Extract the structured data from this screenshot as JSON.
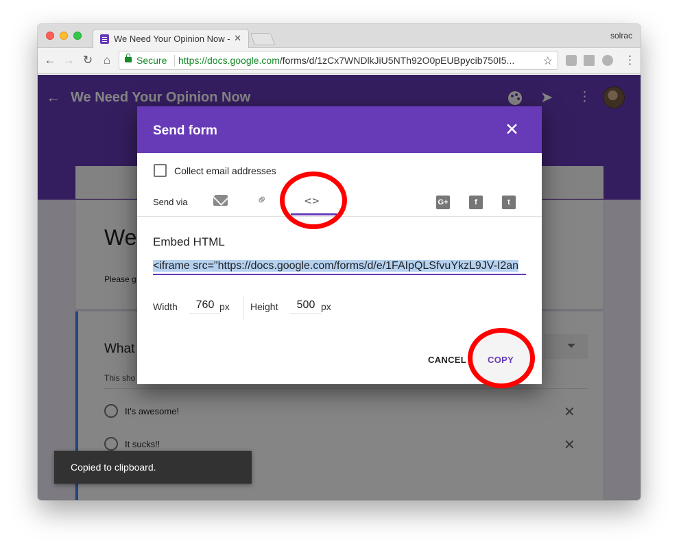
{
  "browser": {
    "tab_title": "We Need Your Opinion Now - G",
    "tab_close": "✕",
    "profile": "solrac",
    "secure_label": "Secure",
    "url_scheme_host": "https://docs.google.com",
    "url_path": "/forms/d/1zCx7WNDlkJiU5NTh92O0pEUBpycib750I5..."
  },
  "form": {
    "title": "We Need Your Opinion Now",
    "card_title": "We",
    "card_desc": "Please g",
    "question_title": "What",
    "question_desc": "This sho",
    "options": [
      {
        "label": "It's awesome!"
      },
      {
        "label": "It sucks!!"
      }
    ]
  },
  "dialog": {
    "title": "Send form",
    "close": "✕",
    "collect_email_label": "Collect email addresses",
    "collect_email_checked": false,
    "send_via_label": "Send via",
    "active_tab": "embed",
    "embed_icon": "<>",
    "social": [
      "G+",
      "f",
      "t"
    ],
    "embed_heading": "Embed HTML",
    "embed_code": "<iframe src=\"https://docs.google.com/forms/d/e/1FAIpQLSfvuYkzL9JV-I2an",
    "width_label": "Width",
    "width_value": "760",
    "height_label": "Height",
    "height_value": "500",
    "unit": "px",
    "cancel_label": "CANCEL",
    "copy_label": "COPY"
  },
  "snackbar": {
    "text": "Copied to clipboard."
  },
  "colors": {
    "brand_purple": "#673ab7",
    "annotation_red": "#ff0000",
    "secure_green": "#158a29"
  },
  "icons": [
    "back-arrow-icon",
    "forward-arrow-icon",
    "reload-icon",
    "home-icon",
    "lock-icon",
    "star-icon",
    "palette-icon",
    "send-icon",
    "more-vert-icon",
    "close-icon",
    "email-icon",
    "link-icon",
    "embed-code-icon",
    "google-plus-icon",
    "facebook-icon",
    "twitter-icon"
  ]
}
